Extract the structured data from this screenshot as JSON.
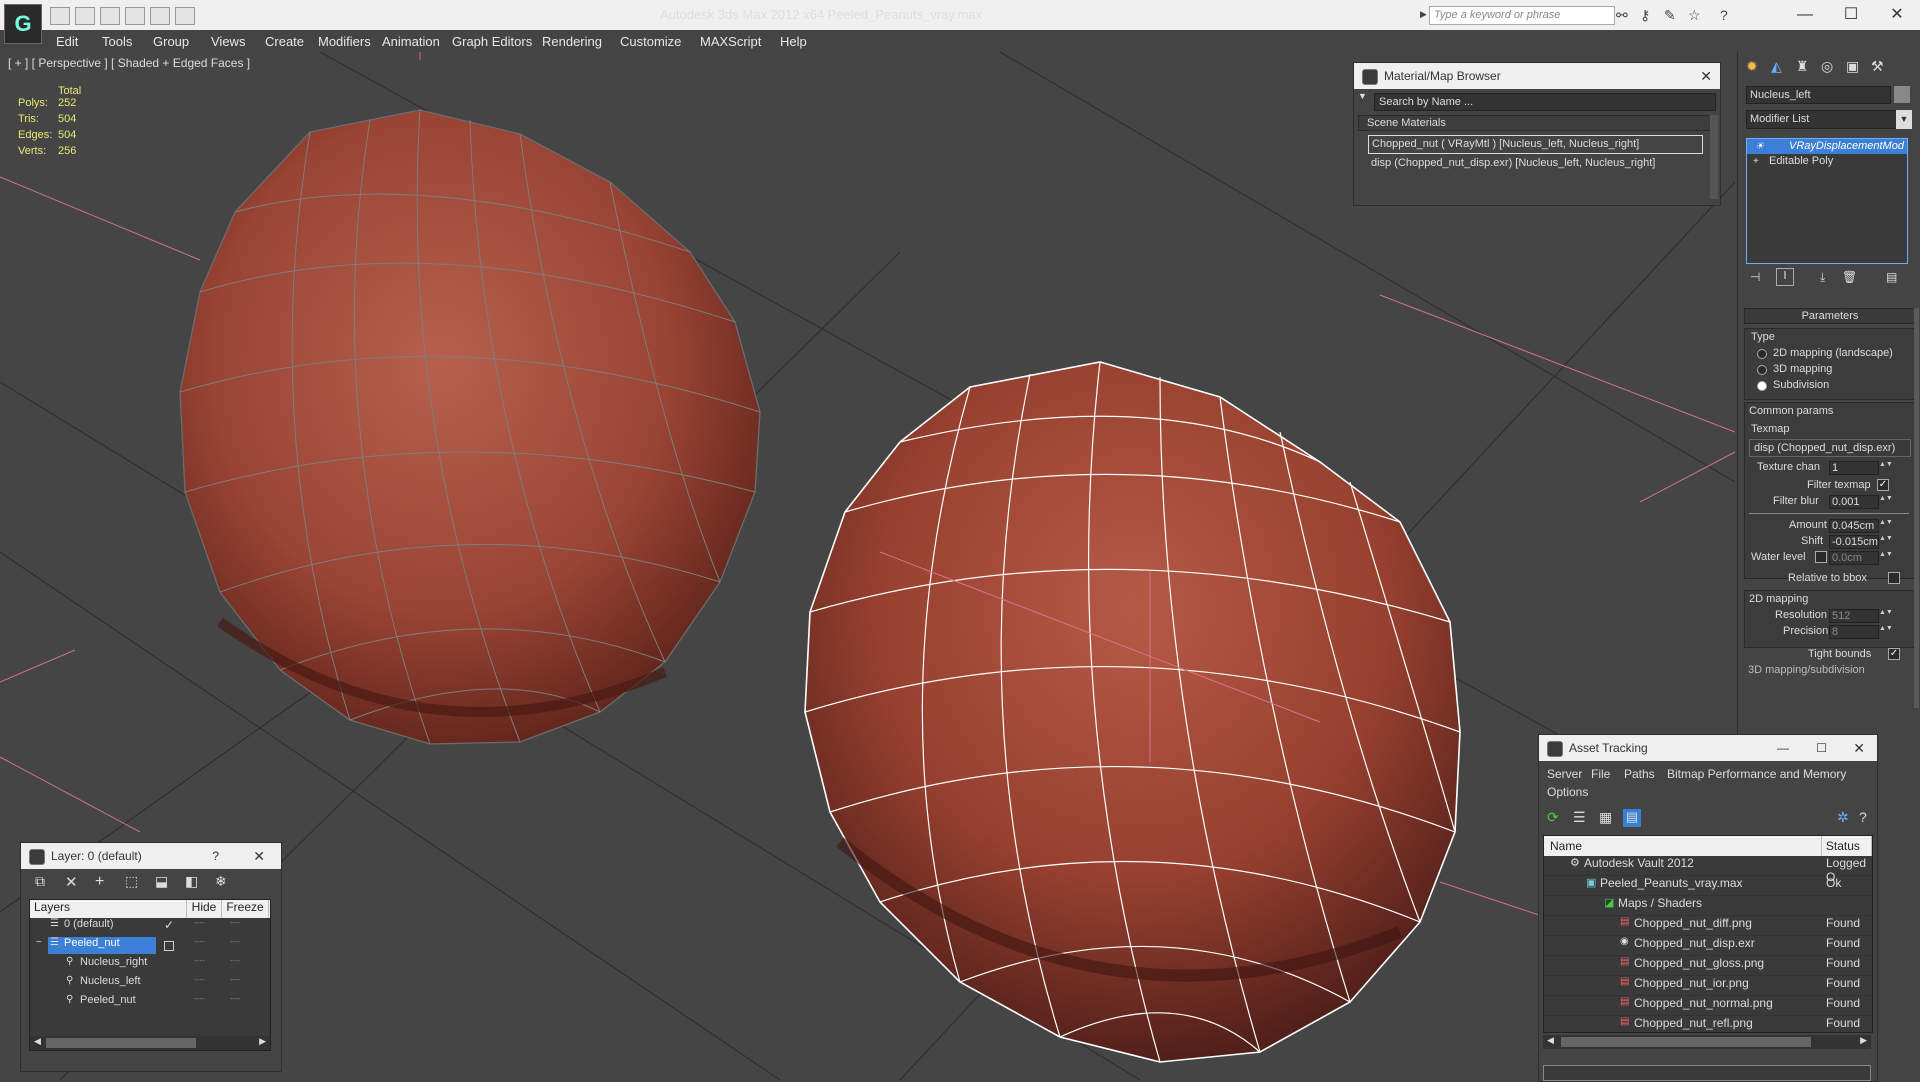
{
  "app": {
    "title": "Autodesk 3ds Max  2012 x64      Peeled_Peanuts_vray.max",
    "search_placeholder": "Type a keyword or phrase",
    "window_controls": {
      "minimize": "—",
      "maximize": "☐",
      "close": "✕"
    }
  },
  "menu": [
    "Edit",
    "Tools",
    "Group",
    "Views",
    "Create",
    "Modifiers",
    "Animation",
    "Graph Editors",
    "Rendering",
    "Customize",
    "MAXScript",
    "Help"
  ],
  "viewport": {
    "label": "[ + ] [ Perspective ] [ Shaded + Edged Faces ]",
    "stats": {
      "header": "Total",
      "rows": [
        {
          "label": "Polys:",
          "value": "252"
        },
        {
          "label": "Tris:",
          "value": "504"
        },
        {
          "label": "Edges:",
          "value": "504"
        },
        {
          "label": "Verts:",
          "value": "256"
        }
      ]
    }
  },
  "material_browser": {
    "title": "Material/Map Browser",
    "search": "Search by Name ...",
    "section": "Scene Materials",
    "items": [
      "Chopped_nut  ( VRayMtl )  [Nucleus_left, Nucleus_right]",
      "disp (Chopped_nut_disp.exr) [Nucleus_left, Nucleus_right]"
    ]
  },
  "command_panel": {
    "object_name": "Nucleus_left",
    "modifier_list": "Modifier List",
    "stack": [
      "VRayDisplacementMod",
      "Editable Poly"
    ],
    "params_title": "Parameters",
    "type_label": "Type",
    "type_options": [
      "2D mapping (landscape)",
      "3D mapping",
      "Subdivision"
    ],
    "selected_type": 2,
    "common_params": "Common params",
    "texmap_label": "Texmap",
    "texmap_value": "disp (Chopped_nut_disp.exr)",
    "texture_chan_label": "Texture chan",
    "texture_chan_value": "1",
    "filter_texmap_label": "Filter texmap",
    "filter_blur_label": "Filter blur",
    "filter_blur_value": "0.001",
    "amount_label": "Amount",
    "amount_value": "0.045cm",
    "shift_label": "Shift",
    "shift_value": "-0.015cm",
    "water_level_label": "Water level",
    "water_level_value": "0.0cm",
    "relative_label": "Relative to bbox",
    "mapping2d_label": "2D mapping",
    "resolution_label": "Resolution",
    "resolution_value": "512",
    "precision_label": "Precision",
    "precision_value": "8",
    "tight_bounds_label": "Tight bounds",
    "mapping3d_label": "3D mapping/subdivision",
    "checkmark": "✓",
    "spinner": "▲▼"
  },
  "layer_panel": {
    "title": "Layer: 0 (default)",
    "help": "?",
    "close": "✕",
    "columns": [
      "Layers",
      "Hide",
      "Freeze"
    ],
    "rows": [
      {
        "name": "0 (default)",
        "indent": 1,
        "selected": false
      },
      {
        "name": "Peeled_nut",
        "indent": 0,
        "selected": true
      },
      {
        "name": "Nucleus_right",
        "indent": 2,
        "selected": false
      },
      {
        "name": "Nucleus_left",
        "indent": 2,
        "selected": false
      },
      {
        "name": "Peeled_nut",
        "indent": 2,
        "selected": false
      }
    ],
    "dash": "----"
  },
  "asset_tracking": {
    "title": "Asset Tracking",
    "menu": [
      "Server",
      "File",
      "Paths",
      "Bitmap Performance and Memory"
    ],
    "menu2": "Options",
    "columns": [
      "Name",
      "Status"
    ],
    "rows": [
      {
        "name": "Autodesk Vault 2012",
        "status": "Logged O",
        "indent": 0
      },
      {
        "name": "Peeled_Peanuts_vray.max",
        "status": "Ok",
        "indent": 1
      },
      {
        "name": "Maps / Shaders",
        "status": "",
        "indent": 2
      },
      {
        "name": "Chopped_nut_diff.png",
        "status": "Found",
        "indent": 3
      },
      {
        "name": "Chopped_nut_disp.exr",
        "status": "Found",
        "indent": 3
      },
      {
        "name": "Chopped_nut_gloss.png",
        "status": "Found",
        "indent": 3
      },
      {
        "name": "Chopped_nut_ior.png",
        "status": "Found",
        "indent": 3
      },
      {
        "name": "Chopped_nut_normal.png",
        "status": "Found",
        "indent": 3
      },
      {
        "name": "Chopped_nut_refl.png",
        "status": "Found",
        "indent": 3
      }
    ]
  },
  "colors": {
    "viewport_bg": "#454545",
    "nut": "#a5493b",
    "wire_left": "#8a8a8a",
    "wire_right": "#ffffff",
    "selection": "#3c7fd6"
  }
}
